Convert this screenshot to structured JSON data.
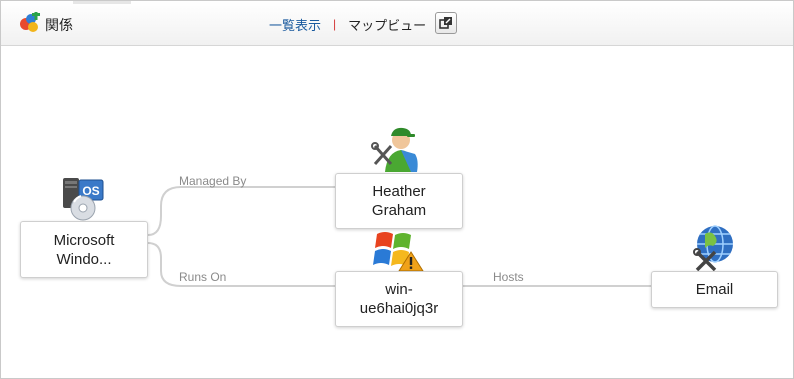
{
  "header": {
    "title": "関係",
    "list_view_label": "一覧表示",
    "separator": "|",
    "map_view_label": "マップビュー"
  },
  "nodes": {
    "microsoft": {
      "label_line1": "Microsoft",
      "label_line2": "Windo...",
      "icon": "os-server-icon"
    },
    "heather": {
      "label_line1": "Heather",
      "label_line2": "Graham",
      "icon": "support-person-icon"
    },
    "host": {
      "label_line1": "win-",
      "label_line2": "ue6hai0jq3r",
      "icon": "windows-warning-icon"
    },
    "email": {
      "label_line1": "Email",
      "icon": "network-service-icon"
    }
  },
  "edges": {
    "managed_by": "Managed By",
    "runs_on": "Runs On",
    "hosts": "Hosts"
  },
  "colors": {
    "link": "#1a5a9e",
    "separator": "#d43a3a",
    "edge": "#d0d0d0",
    "edge_label": "#8a8a8a"
  }
}
